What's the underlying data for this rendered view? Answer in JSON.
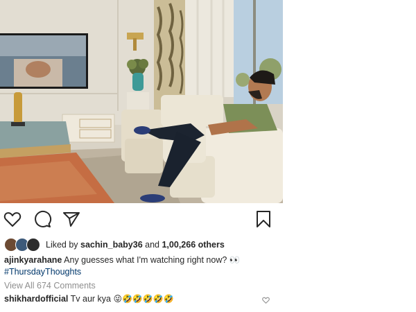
{
  "post": {
    "photo_alt": "Man in green t-shirt seated in a cream armchair watching a wall-mounted TV"
  },
  "actions": {
    "like_icon": "heart-outline-icon",
    "comment_icon": "speech-bubble-icon",
    "share_icon": "paper-plane-icon",
    "save_icon": "bookmark-icon"
  },
  "likes": {
    "prefix": "Liked by ",
    "user": "sachin_baby36",
    "middle": " and ",
    "count": "1,00,266 others"
  },
  "caption": {
    "username": "ajinkyarahane",
    "text": " Any guesses what I'm watching right now? 👀",
    "hashtag": "#ThursdayThoughts"
  },
  "view_all_comments": "View All 674 Comments",
  "comment": {
    "username": "shikhardofficial",
    "text": " Tv  aur kya ",
    "emojis": "😜🤣🤣🤣🤣🤣"
  },
  "colors": {
    "text": "#262626",
    "muted": "#8e8e8e",
    "hashtag": "#00376b"
  }
}
